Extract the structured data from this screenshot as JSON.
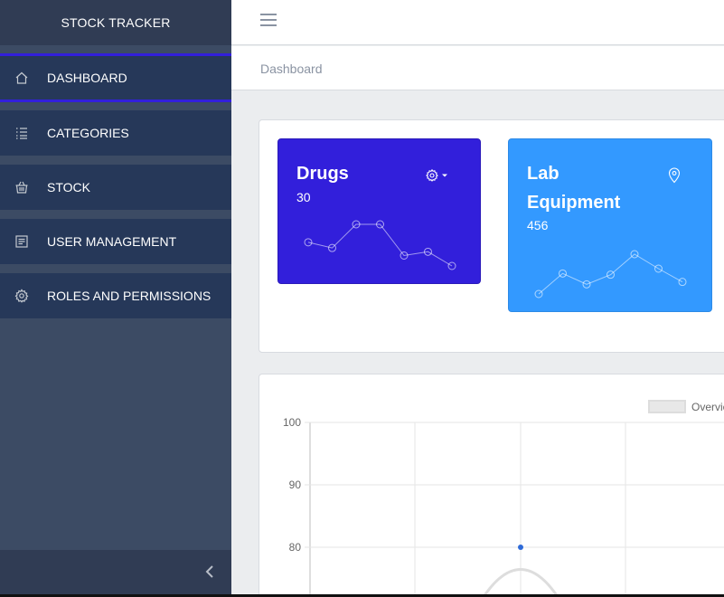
{
  "app": {
    "title": "STOCK TRACKER"
  },
  "sidebar": {
    "items": [
      {
        "label": "DASHBOARD",
        "icon": "home-icon",
        "active": true
      },
      {
        "label": "CATEGORIES",
        "icon": "list-icon",
        "active": false
      },
      {
        "label": "STOCK",
        "icon": "basket-icon",
        "active": false
      },
      {
        "label": "USER MANAGEMENT",
        "icon": "document-icon",
        "active": false
      },
      {
        "label": "ROLES AND PERMISSIONS",
        "icon": "gear-icon",
        "active": false
      }
    ],
    "toggler_icon": "chevron-left-icon"
  },
  "header": {
    "menu_icon": "hamburger-icon"
  },
  "breadcrumb": {
    "current": "Dashboard"
  },
  "cards": [
    {
      "title": "Drugs",
      "value": "30",
      "color": "#321fdb",
      "action_icon": "gear-dropdown-icon",
      "sparkline": [
        65,
        59,
        84,
        84,
        51,
        55,
        40
      ]
    },
    {
      "title": "Lab Equipment",
      "value": "456",
      "color": "#3399ff",
      "action_icon": "location-pin-icon",
      "sparkline": [
        1,
        18,
        9,
        17,
        34,
        22,
        11
      ]
    }
  ],
  "chart_data": {
    "type": "line",
    "series": [
      {
        "name": "Overview",
        "point_color": "#2e6ad8",
        "line_color": "#dddddd"
      }
    ],
    "y_ticks": [
      100,
      90,
      80
    ],
    "ylim": [
      70,
      100
    ],
    "peak": {
      "y": 80
    },
    "legend": "top-right",
    "grid": true
  }
}
